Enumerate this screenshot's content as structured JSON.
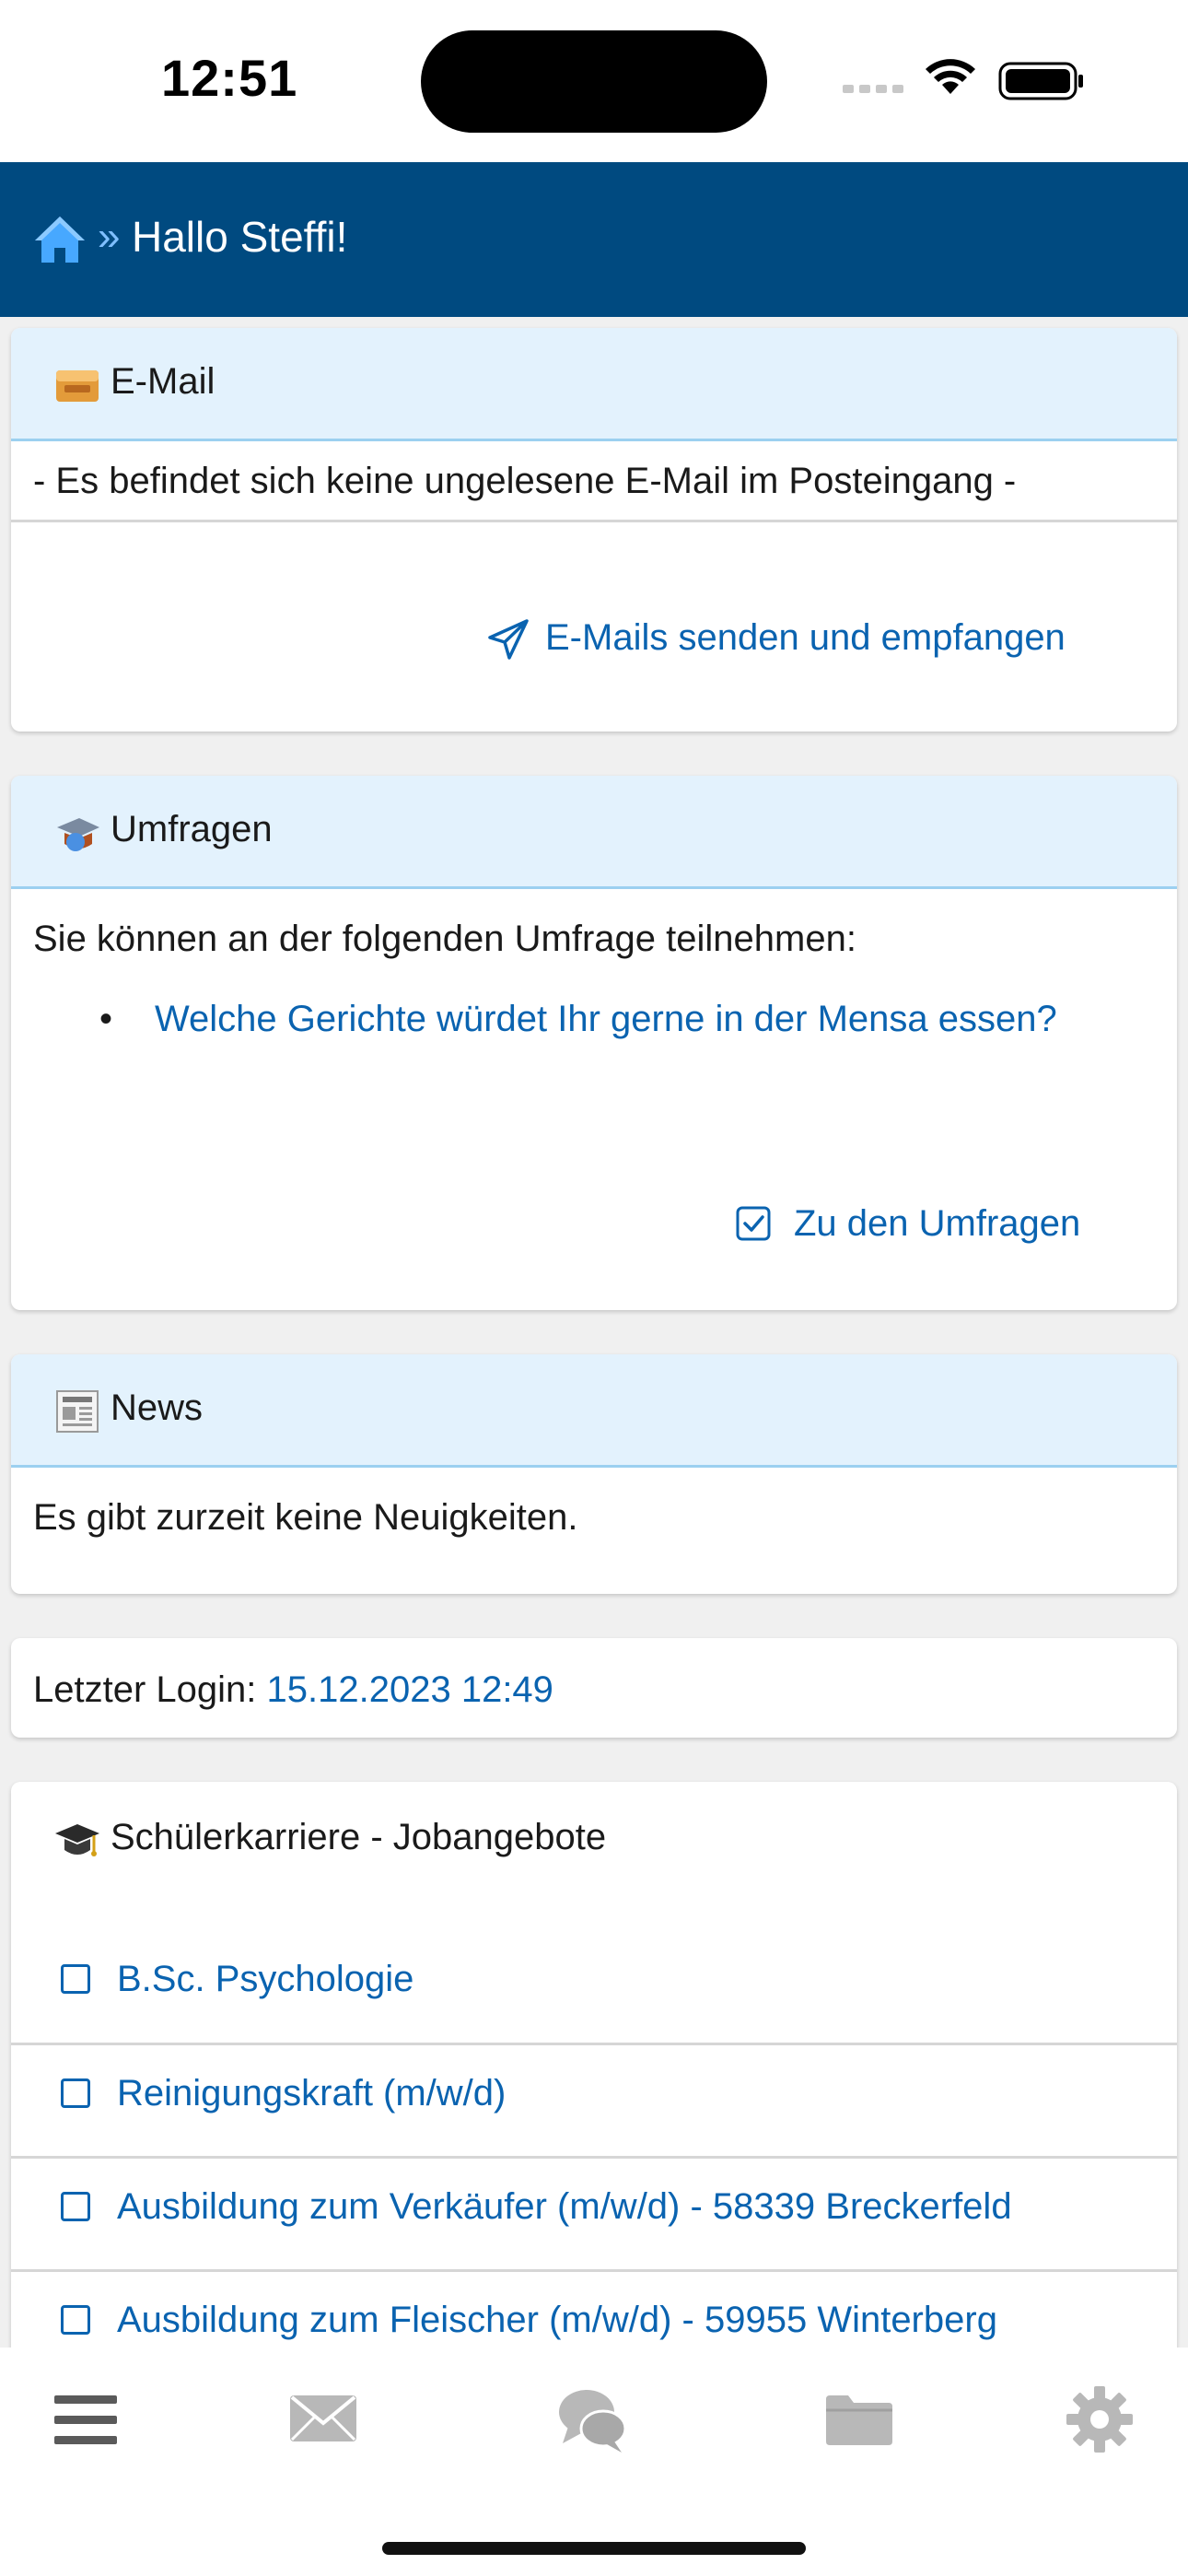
{
  "status_bar": {
    "time": "12:51"
  },
  "header": {
    "separator": "»",
    "title": "Hallo Steffi!"
  },
  "email": {
    "title": "E-Mail",
    "message": "- Es befindet sich keine ungelesene E-Mail im Posteingang -",
    "action": "E-Mails senden und empfangen"
  },
  "surveys": {
    "title": "Umfragen",
    "intro": "Sie können an der folgenden Umfrage teilnehmen:",
    "items": [
      "Welche Gerichte würdet Ihr gerne in der Mensa essen?"
    ],
    "action": "Zu den Umfragen"
  },
  "news": {
    "title": "News",
    "message": "Es gibt zurzeit keine Neuigkeiten."
  },
  "last_login": {
    "label": "Letzter Login:",
    "value": "15.12.2023 12:49"
  },
  "jobs": {
    "title": "Schülerkarriere - Jobangebote",
    "items": [
      "B.Sc. Psychologie",
      "Reinigungskraft (m/w/d)",
      "Ausbildung zum Verkäufer (m/w/d) - 58339 Breckerfeld",
      "Ausbildung zum Fleischer (m/w/d) - 59955 Winterberg"
    ]
  },
  "tabbar": {
    "items": [
      {
        "icon": "menu-icon"
      },
      {
        "icon": "mail-icon"
      },
      {
        "icon": "chat-icon"
      },
      {
        "icon": "folder-icon"
      },
      {
        "icon": "gear-icon"
      }
    ]
  },
  "colors": {
    "header_bg": "#004a80",
    "card_header_bg": "#e3f2fd",
    "link": "#0a63b0",
    "page_bg": "#f0f0f0"
  }
}
